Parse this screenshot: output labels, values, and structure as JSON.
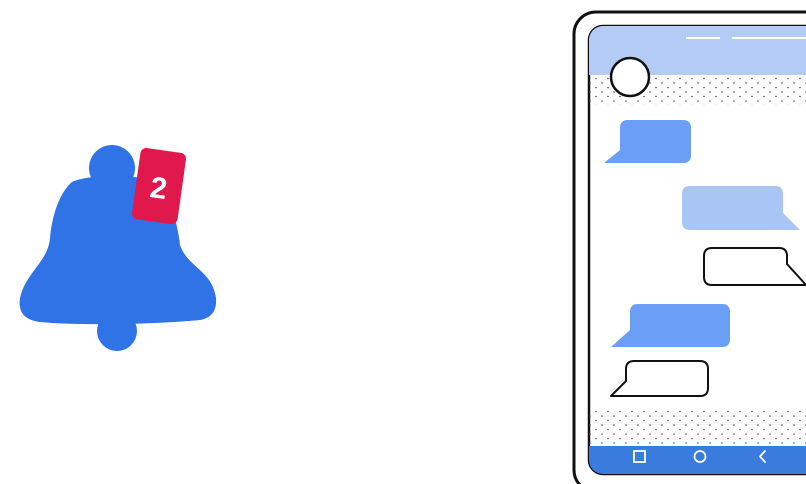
{
  "notification": {
    "badge_count": "2",
    "bell_color": "#2F73E6",
    "badge_color": "#E0184C",
    "badge_text_color": "#FFFFFF"
  },
  "phone": {
    "frame_color": "#111111",
    "header_color": "#B4CCF5",
    "nav_bar_color": "#3A7BDE",
    "nav_icon_color": "#FFFFFF",
    "nav_buttons": [
      "square-icon",
      "circle-icon",
      "back-chevron-icon"
    ],
    "messages": [
      {
        "side": "incoming",
        "style": "filled",
        "color": "#6B9EF5"
      },
      {
        "side": "outgoing",
        "style": "filled",
        "color": "#A9C5F3"
      },
      {
        "side": "outgoing",
        "style": "outline",
        "color": "#FFFFFF"
      },
      {
        "side": "incoming",
        "style": "filled",
        "color": "#6B9EF5"
      },
      {
        "side": "incoming",
        "style": "outline",
        "color": "#FFFFFF"
      }
    ]
  }
}
